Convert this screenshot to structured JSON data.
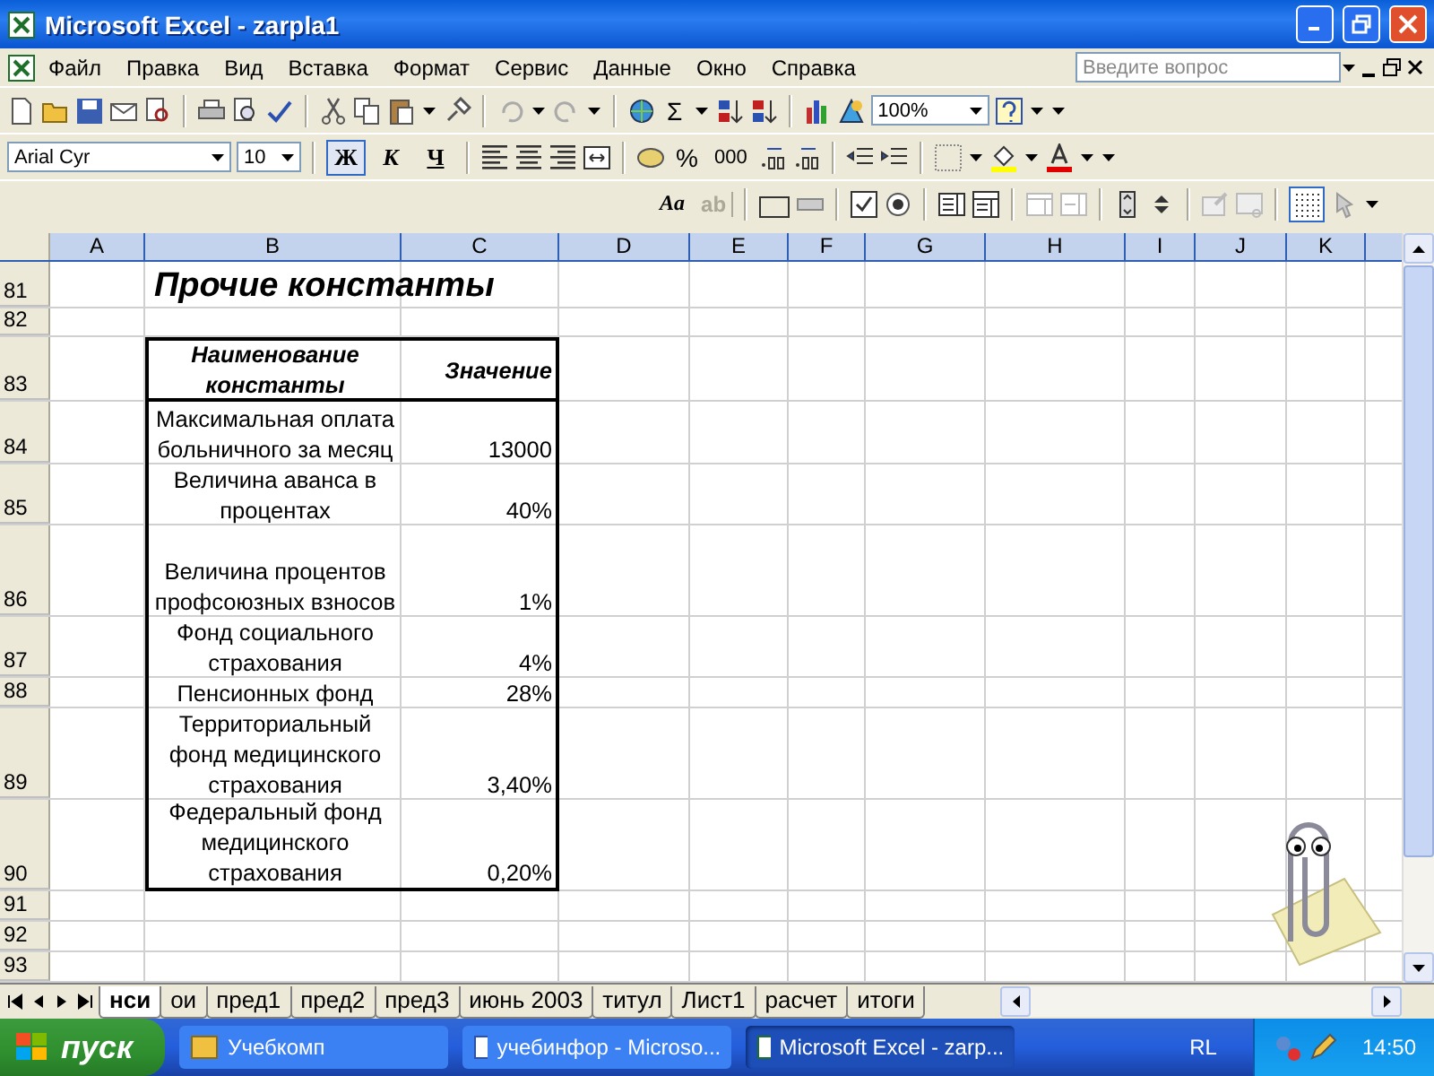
{
  "window": {
    "title": "Microsoft Excel - zarpla1"
  },
  "menu": [
    "Файл",
    "Правка",
    "Вид",
    "Вставка",
    "Формат",
    "Сервис",
    "Данные",
    "Окно",
    "Справка"
  ],
  "help_search": {
    "placeholder": "Введите вопрос"
  },
  "standard_toolbar": {
    "sum": "Σ",
    "zoom": "100%"
  },
  "formatting_toolbar": {
    "font": "Arial Cyr",
    "size": "10",
    "bold": {
      "label": "Ж",
      "selected": true
    },
    "italic": {
      "label": "К",
      "selected": false
    },
    "underline": {
      "label": "Ч",
      "selected": false
    },
    "percent": "%",
    "thousands": "000"
  },
  "forms_toolbar": {
    "tools": [
      {
        "label": "Aa",
        "disabled": false
      },
      {
        "label": "ab",
        "disabled": true
      }
    ],
    "grid_button": {
      "selected": true
    }
  },
  "sheet": {
    "columns": [
      "A",
      "B",
      "C",
      "D",
      "E",
      "F",
      "G",
      "H",
      "I",
      "J",
      "K"
    ],
    "rows": [
      {
        "number": "81",
        "kind": "title",
        "b": "Прочие константы"
      },
      {
        "number": "82",
        "kind": "blank"
      },
      {
        "number": "83",
        "kind": "header",
        "b": "Наименование константы",
        "c": "Значение"
      },
      {
        "number": "84",
        "kind": "data",
        "b": "Максимальная оплата больничного за месяц",
        "c": "13000"
      },
      {
        "number": "85",
        "kind": "data",
        "b": "Величина аванса в процентах",
        "c": "40%"
      },
      {
        "number": "86",
        "kind": "data",
        "b": "Величина процентов профсоюзных взносов",
        "c": "1%"
      },
      {
        "number": "87",
        "kind": "data",
        "b": "Фонд социального страхования",
        "c": "4%"
      },
      {
        "number": "88",
        "kind": "data",
        "b": "Пенсионных фонд",
        "c": "28%"
      },
      {
        "number": "89",
        "kind": "data",
        "b": "Территориальный фонд медицинского страхования",
        "c": "3,40%"
      },
      {
        "number": "90",
        "kind": "data",
        "b": "Федеральный фонд медицинского страхования",
        "c": "0,20%"
      },
      {
        "number": "91",
        "kind": "blank"
      },
      {
        "number": "92",
        "kind": "blank"
      },
      {
        "number": "93",
        "kind": "blank"
      }
    ]
  },
  "sheet_tabs": [
    {
      "label": "нси",
      "selected": true
    },
    {
      "label": "ои",
      "selected": false
    },
    {
      "label": "пред1",
      "selected": false
    },
    {
      "label": "пред2",
      "selected": false
    },
    {
      "label": "пред3",
      "selected": false
    },
    {
      "label": "июнь 2003",
      "selected": false
    },
    {
      "label": "титул",
      "selected": false
    },
    {
      "label": "Лист1",
      "selected": false
    },
    {
      "label": "расчет",
      "selected": false
    },
    {
      "label": "итоги",
      "selected": false
    }
  ],
  "taskbar": {
    "start": "пуск",
    "tasks": [
      {
        "label": "Учебкомп",
        "selected": false
      },
      {
        "label": "учебинфор - Microso...",
        "selected": false
      },
      {
        "label": "Microsoft Excel - zarp...",
        "selected": true
      }
    ],
    "language": "RL",
    "clock": "14:50"
  }
}
